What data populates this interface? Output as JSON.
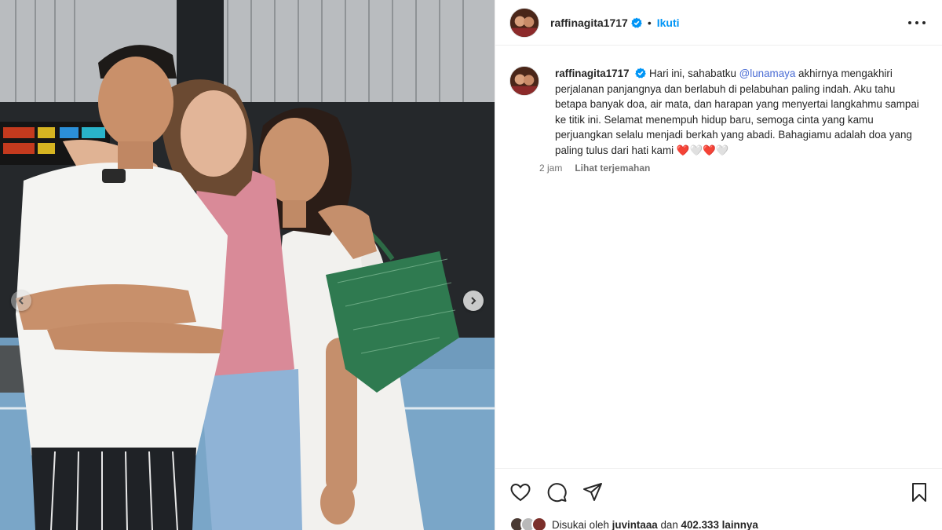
{
  "post": {
    "username": "raffinagita1717",
    "follow_label": "Ikuti",
    "separator": "•"
  },
  "caption": {
    "username": "raffinagita1717",
    "text_before_mention": "Hari ini, sahabatku ",
    "mention": "@lunamaya",
    "text_after_mention": " akhirnya mengakhiri perjalanan panjangnya dan berlabuh di pelabuhan paling indah. Aku tahu betapa banyak doa, air mata, dan harapan yang menyertai langkahmu sampai ke titik ini. Selamat menempuh hidup baru, semoga cinta yang kamu perjuangkan selalu menjadi berkah yang abadi. Bahagiamu adalah doa yang paling tulus dari hati kami ",
    "emoji_tail": "❤️🤍❤️🤍",
    "time": "2 jam",
    "translate_label": "Lihat terjemahan"
  },
  "likes": {
    "prefix": "Disukai oleh ",
    "liker": "juvintaaa",
    "middle": " dan ",
    "count": "402.333",
    "suffix": " lainnya"
  },
  "icons": {
    "like": "heart-outline-icon",
    "comment": "comment-bubble-icon",
    "share": "paper-plane-icon",
    "save": "bookmark-icon",
    "more": "more-dots-icon",
    "verified": "verified-badge-icon"
  },
  "colors": {
    "accent": "#0095f6",
    "mention": "#4a6cd4",
    "verified": "#0095f6",
    "heart": "#e0161f",
    "text": "#262626",
    "secondary": "#737373"
  }
}
